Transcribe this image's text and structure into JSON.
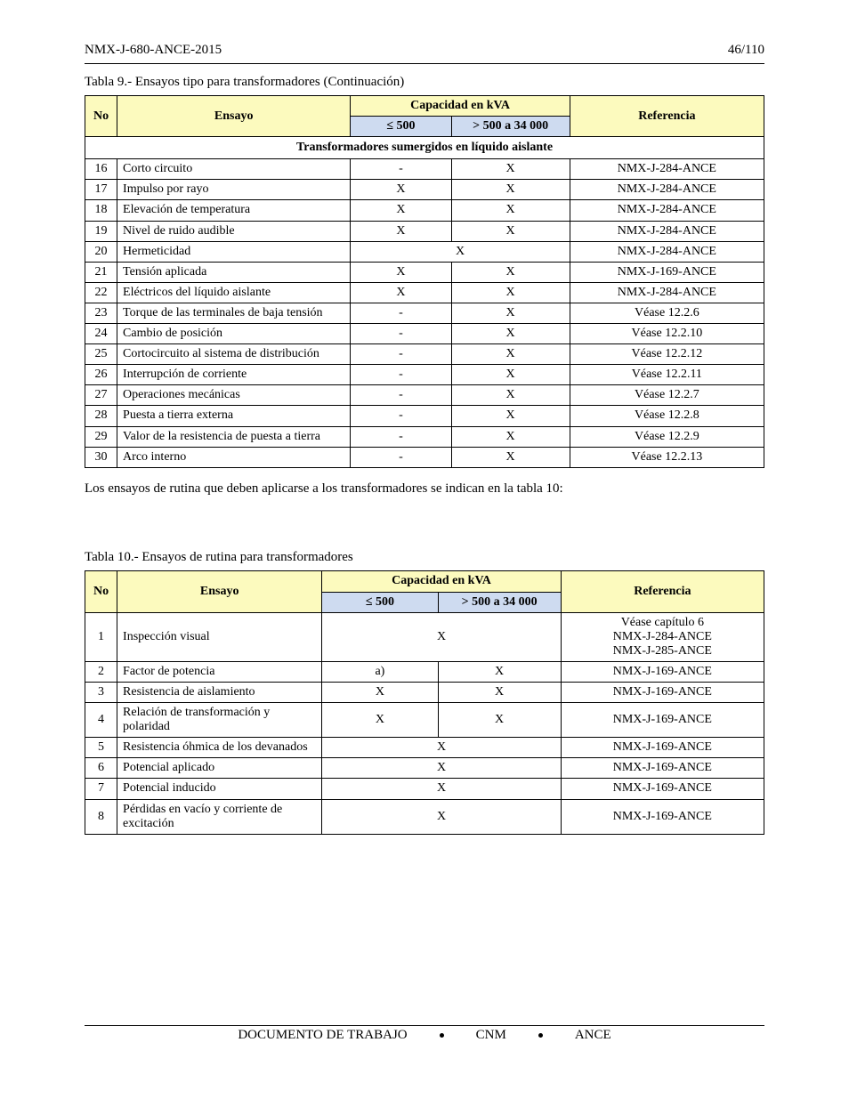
{
  "header": {
    "left": "NMX-J-680-ANCE-2015",
    "right": "46/110"
  },
  "footer": {
    "left": "DOCUMENTO DE TRABAJO",
    "center": "CNM",
    "right": "ANCE"
  },
  "table9": {
    "caption": "Tabla 9.- Ensayos tipo para transformadores (Continuación)",
    "headers": {
      "no": "No",
      "ensayo": "Ensayo",
      "cap_group": "Capacidad en kVA",
      "cap_left": "≤ 500",
      "cap_right": "> 500 a 34 000",
      "ref": "Referencia"
    },
    "section": "Transformadores sumergidos en líquido aislante",
    "rows": [
      {
        "no": "16",
        "ensayo": "Corto circuito",
        "cap_l": "-",
        "cap_r": "X",
        "ref": "NMX-J-284-ANCE"
      },
      {
        "no": "17",
        "ensayo": "Impulso por rayo",
        "cap_l": "X",
        "cap_r": "X",
        "ref": "NMX-J-284-ANCE"
      },
      {
        "no": "18",
        "ensayo": "Elevación de temperatura",
        "cap_l": "X",
        "cap_r": "X",
        "ref": "NMX-J-284-ANCE"
      },
      {
        "no": "19",
        "ensayo": "Nivel de ruido audible",
        "cap_l": "X",
        "cap_r": "X",
        "ref": "NMX-J-284-ANCE"
      },
      {
        "no": "20",
        "ensayo": "Hermeticidad",
        "cap_span": "X",
        "ref": "NMX-J-284-ANCE"
      },
      {
        "no": "21",
        "ensayo": "Tensión aplicada",
        "cap_l": "X",
        "cap_r": "X",
        "ref": "NMX-J-169-ANCE"
      },
      {
        "no": "22",
        "ensayo": "Eléctricos del líquido aislante",
        "cap_l": "X",
        "cap_r": "X",
        "ref": "NMX-J-284-ANCE"
      },
      {
        "no": "23",
        "ensayo": "Torque de las terminales de baja tensión",
        "cap_l": "-",
        "cap_r": "X",
        "ref": "Véase 12.2.6"
      },
      {
        "no": "24",
        "ensayo": "Cambio de posición",
        "cap_l": "-",
        "cap_r": "X",
        "ref": "Véase 12.2.10"
      },
      {
        "no": "25",
        "ensayo": "Cortocircuito al sistema de distribución",
        "cap_l": "-",
        "cap_r": "X",
        "ref": "Véase 12.2.12"
      },
      {
        "no": "26",
        "ensayo": "Interrupción de corriente",
        "cap_l": "-",
        "cap_r": "X",
        "ref": "Véase 12.2.11"
      },
      {
        "no": "27",
        "ensayo": "Operaciones mecánicas",
        "cap_l": "-",
        "cap_r": "X",
        "ref": "Véase 12.2.7"
      },
      {
        "no": "28",
        "ensayo": "Puesta a tierra externa",
        "cap_l": "-",
        "cap_r": "X",
        "ref": "Véase 12.2.8"
      },
      {
        "no": "29",
        "ensayo": "Valor de la resistencia de puesta a tierra",
        "cap_l": "-",
        "cap_r": "X",
        "ref": "Véase 12.2.9"
      },
      {
        "no": "30",
        "ensayo": "Arco interno",
        "cap_l": "-",
        "cap_r": "X",
        "ref": "Véase 12.2.13"
      }
    ]
  },
  "table10": {
    "caption": "Tabla 10.- Ensayos de rutina para transformadores",
    "preface": "Los ensayos de rutina que deben aplicarse a los transformadores se indican en la tabla 10:",
    "headers": {
      "no": "No",
      "ensayo": "Ensayo",
      "cap_group": "Capacidad en kVA",
      "cap_left": "≤ 500",
      "cap_right": "> 500 a 34 000",
      "ref": "Referencia"
    },
    "rows": [
      {
        "no": "1",
        "ensayo": "Inspección visual",
        "cap_span": "X",
        "ref_lines": [
          "Véase capítulo 6",
          "NMX-J-284-ANCE",
          "NMX-J-285-ANCE"
        ]
      },
      {
        "no": "2",
        "ensayo": "Factor de potencia",
        "cap_l": "a)",
        "cap_r": "X",
        "ref": "NMX-J-169-ANCE"
      },
      {
        "no": "3",
        "ensayo": "Resistencia de aislamiento",
        "cap_l": "X",
        "cap_r": "X",
        "ref": "NMX-J-169-ANCE"
      },
      {
        "no": "4",
        "ensayo": "Relación de transformación y polaridad",
        "cap_l": "X",
        "cap_r": "X",
        "ref": "NMX-J-169-ANCE"
      },
      {
        "no": "5",
        "ensayo": "Resistencia óhmica de los devanados",
        "cap_span": "X",
        "ref": "NMX-J-169-ANCE"
      },
      {
        "no": "6",
        "ensayo": "Potencial aplicado",
        "cap_span": "X",
        "ref": "NMX-J-169-ANCE"
      },
      {
        "no": "7",
        "ensayo": "Potencial inducido",
        "cap_span": "X",
        "ref": "NMX-J-169-ANCE"
      },
      {
        "no": "8",
        "ensayo": "Pérdidas en vacío y corriente de excitación",
        "cap_span": "X",
        "ref": "NMX-J-169-ANCE"
      }
    ]
  }
}
